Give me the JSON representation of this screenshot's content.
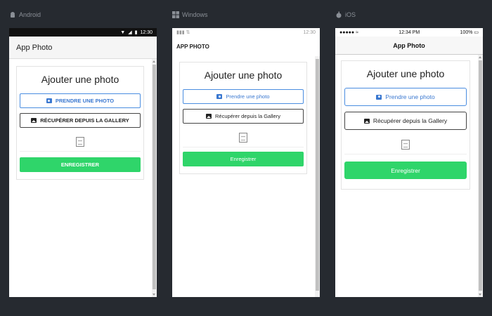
{
  "platforms": {
    "android": {
      "label": "Android"
    },
    "windows": {
      "label": "Windows"
    },
    "ios": {
      "label": "iOS"
    }
  },
  "android": {
    "status_time": "12:30",
    "app_title": "App Photo",
    "card_title": "Ajouter une photo",
    "btn_take": "PRENDRE UNE PHOTO",
    "btn_gallery": "RÉCUPÉRER DEPUIS LA GALLERY",
    "btn_save": "ENREGISTRER"
  },
  "windows": {
    "status_time": "12:30",
    "app_title": "APP PHOTO",
    "card_title": "Ajouter une photo",
    "btn_take": "Prendre une photo",
    "btn_gallery": "Récupérer depuis la Gallery",
    "btn_save": "Enregistrer"
  },
  "ios": {
    "status_time": "12:34 PM",
    "status_battery": "100%",
    "app_title": "App Photo",
    "card_title": "Ajouter une photo",
    "btn_take": "Prendre une photo",
    "btn_gallery": "Récupérer depuis la Gallery",
    "btn_save": "Enregistrer"
  },
  "colors": {
    "background": "#262a30",
    "primary_blue": "#3a78d0",
    "save_green": "#2fd56a"
  },
  "icons": {
    "android_platform": "android-icon",
    "windows_platform": "windows-icon",
    "ios_platform": "apple-icon",
    "take_photo": "camera-icon",
    "gallery": "image-icon",
    "image_placeholder": "broken-image-icon"
  }
}
